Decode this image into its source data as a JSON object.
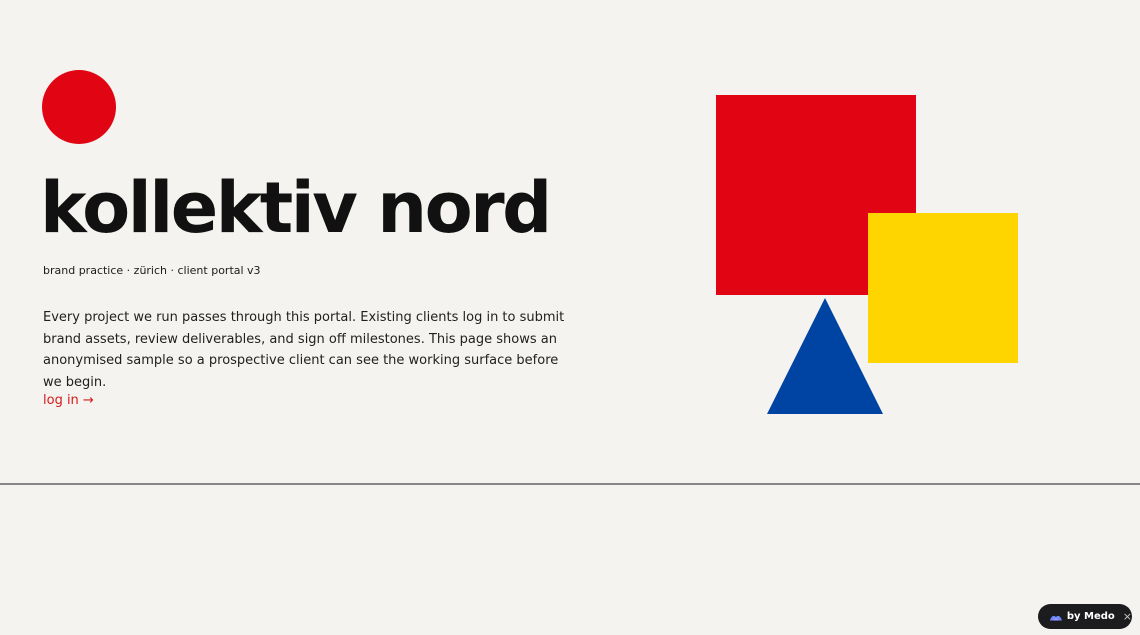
{
  "hero": {
    "title": "kollektiv nord",
    "subtitle": "brand practice · zürich · client portal v3",
    "intro": "Every project we run passes through this portal. Existing clients log in to submit brand assets, review deliverables, and sign off milestones. This page shows an anonymised sample so a prospective client can see the working surface before we begin.",
    "login_label": "log in →"
  },
  "colors": {
    "background": "#f5f3ef",
    "accent_red": "#e10514",
    "accent_yellow": "#ffd500",
    "accent_blue": "#0044a3",
    "link": "#d51a1a",
    "divider": "#878787"
  },
  "decor": {
    "shapes": [
      "red-circle",
      "red-square",
      "yellow-square",
      "blue-triangle"
    ]
  },
  "badge": {
    "label": "by Medo",
    "close": "×"
  }
}
